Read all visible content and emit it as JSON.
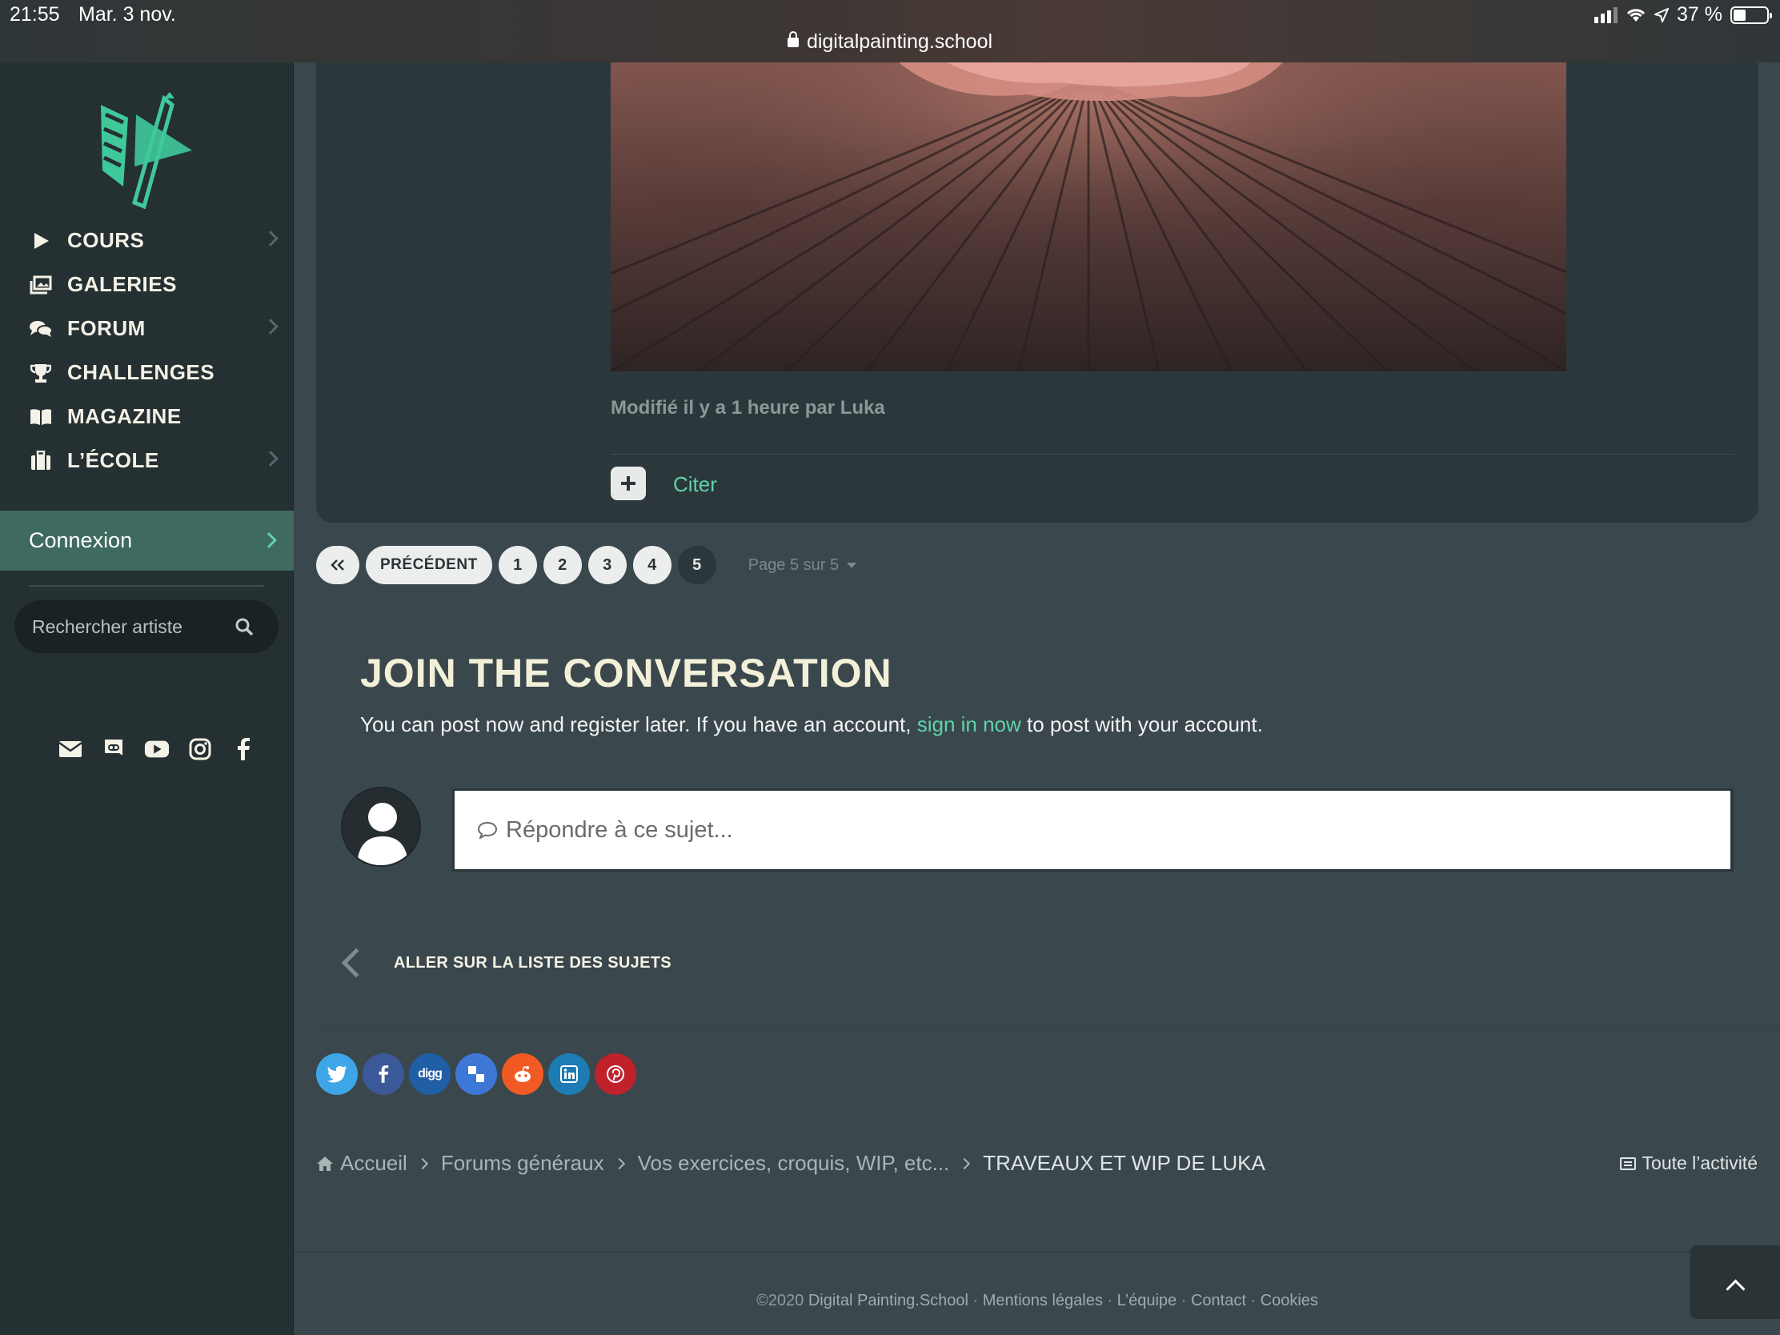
{
  "statusbar": {
    "time": "21:55",
    "date": "Mar. 3 nov.",
    "url": "digitalpainting.school",
    "battery": "37 %"
  },
  "sidebar": {
    "items": [
      {
        "label": "COURS",
        "icon": "play-icon",
        "has_submenu": true
      },
      {
        "label": "GALERIES",
        "icon": "gallery-icon",
        "has_submenu": false
      },
      {
        "label": "FORUM",
        "icon": "forum-icon",
        "has_submenu": true
      },
      {
        "label": "CHALLENGES",
        "icon": "trophy-icon",
        "has_submenu": false
      },
      {
        "label": "MAGAZINE",
        "icon": "book-icon",
        "has_submenu": false
      },
      {
        "label": "L’ÉCOLE",
        "icon": "school-icon",
        "has_submenu": true
      }
    ],
    "login_label": "Connexion",
    "search_placeholder": "Rechercher artiste",
    "socials": [
      "mail-icon",
      "discord-icon",
      "youtube-icon",
      "instagram-icon",
      "facebook-icon"
    ]
  },
  "post": {
    "modified_text": "Modifié il y a 1 heure par Luka",
    "quote_label": "Citer"
  },
  "pagination": {
    "prev_label": "PRÉCÉDENT",
    "pages": [
      "1",
      "2",
      "3",
      "4",
      "5"
    ],
    "current": "5",
    "info": "Page 5 sur 5"
  },
  "join": {
    "title": "JOIN THE CONVERSATION",
    "text_before": "You can post now and register later. If you have an account, ",
    "link": "sign in now",
    "text_after": " to post with your account.",
    "reply_placeholder": "Répondre à ce sujet..."
  },
  "back_label": "ALLER SUR LA LISTE DES SUJETS",
  "share": [
    {
      "name": "twitter",
      "color": "#3ea6e8"
    },
    {
      "name": "facebook",
      "color": "#3b5998"
    },
    {
      "name": "digg",
      "color": "#205ea5"
    },
    {
      "name": "delicious",
      "color": "#3e78d6"
    },
    {
      "name": "reddit",
      "color": "#f15a23"
    },
    {
      "name": "linkedin",
      "color": "#1e7bb3"
    },
    {
      "name": "pinterest",
      "color": "#c0212b"
    }
  ],
  "breadcrumb": {
    "items": [
      "Accueil",
      "Forums généraux",
      "Vos exercices, croquis, WIP, etc...",
      "TRAVEAUX ET WIP DE LUKA"
    ],
    "activity": "Toute l’activité"
  },
  "footer": {
    "copyright": "©2020",
    "links": [
      "Digital Painting.School",
      "Mentions légales",
      "L’équipe",
      "Contact",
      "Cookies"
    ],
    "separator": " · "
  },
  "colors": {
    "accent": "#5fd3a9",
    "sidebar_bg": "#253033",
    "main_bg": "#3a474c",
    "heading": "#f3f0d9"
  }
}
